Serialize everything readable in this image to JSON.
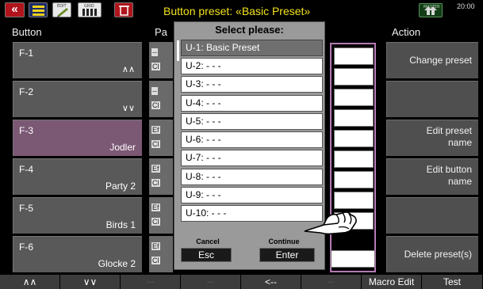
{
  "topbar": {
    "title": "Button preset: «Basic Preset»",
    "back_glyph": "«",
    "clock": "20:00",
    "icons": [
      "back-icon",
      "registration-bars-icon",
      "edit-icon",
      "grid-icon",
      "trash-icon",
      "master-icon"
    ],
    "icon_small_labels": {
      "edit": "EDIT",
      "grid": "GRID",
      "master": "MASTER"
    }
  },
  "headers": {
    "button": "Button",
    "param": "Pa",
    "action": "Action"
  },
  "buttons": [
    {
      "id": "F-1",
      "name": "",
      "icon": "∧∧"
    },
    {
      "id": "F-2",
      "name": "",
      "icon": "∨∨"
    },
    {
      "id": "F-3",
      "name": "Jodler",
      "icon": ""
    },
    {
      "id": "F-4",
      "name": "Party 2",
      "icon": ""
    },
    {
      "id": "F-5",
      "name": "Birds 1",
      "icon": ""
    },
    {
      "id": "F-6",
      "name": "Glocke 2",
      "icon": ""
    }
  ],
  "param_cells": [
    {
      "top": "--",
      "bottom": "Cl"
    },
    {
      "top": "--",
      "bottom": "Cl"
    },
    {
      "top": "Ef",
      "bottom": "Cl"
    },
    {
      "top": "Ef",
      "bottom": "Cl"
    },
    {
      "top": "Ef",
      "bottom": "Cl"
    },
    {
      "top": "Ef",
      "bottom": "Cl"
    }
  ],
  "actions": [
    {
      "label": "Change preset"
    },
    {
      "label": ""
    },
    {
      "label": "Edit preset\nname"
    },
    {
      "label": "Edit button\nname"
    },
    {
      "label": ""
    },
    {
      "label": "Delete preset(s)"
    }
  ],
  "popup": {
    "title": "Select please:",
    "options": [
      "U-1: Basic Preset",
      "U-2: - - -",
      "U-3: - - -",
      "U-4: - - -",
      "U-5: - - -",
      "U-6: - - -",
      "U-7: - - -",
      "U-8: - - -",
      "U-9: - - -",
      "U-10: - - -"
    ],
    "selected_index": 0,
    "cancel_label": "Cancel",
    "cancel_key": "Esc",
    "continue_label": "Continue",
    "continue_key": "Enter"
  },
  "bottom_nav": [
    {
      "label": "∧∧",
      "enabled": true
    },
    {
      "label": "∨∨",
      "enabled": true
    },
    {
      "label": "---",
      "enabled": false
    },
    {
      "label": "---",
      "enabled": false
    },
    {
      "label": "<--",
      "enabled": true
    },
    {
      "label": "---",
      "enabled": false
    },
    {
      "label": "Macro Edit",
      "enabled": true
    },
    {
      "label": "Test",
      "enabled": true
    }
  ],
  "colors": {
    "title": "#f3e21a",
    "selected_button": "#7b5874",
    "button": "#595959",
    "frame_accent": "#b67ab4",
    "popup_bg": "#9a9a9a"
  }
}
